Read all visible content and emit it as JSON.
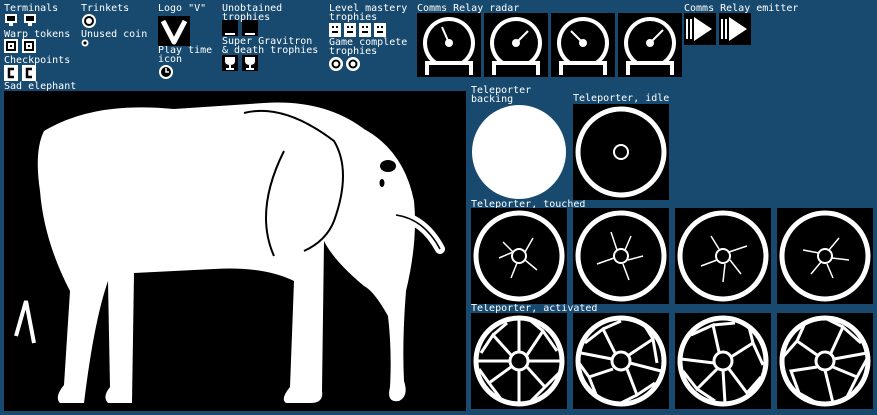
{
  "labels": {
    "terminals": "Terminals",
    "warp_tokens": "Warp tokens",
    "checkpoints": "Checkpoints",
    "sad_elephant": "Sad elephant",
    "trinkets": "Trinkets",
    "unused_coin": "Unused coin",
    "logo_v": "Logo \"V\"",
    "play_time_1": "Play time",
    "play_time_2": "icon",
    "unobtained_1": "Unobtained",
    "unobtained_2": "trophies",
    "super_1": "Super Gravitron",
    "super_2": "& death trophies",
    "level_mastery_1": "Level mastery",
    "level_mastery_2": "trophies",
    "game_complete_1": "Game complete",
    "game_complete_2": "trophies",
    "radar": "Comms Relay radar",
    "emitter": "Comms Relay emitter",
    "tp_backing_1": "Teleporter",
    "tp_backing_2": "backing",
    "tp_idle": "Teleporter, idle",
    "tp_touched": "Teleporter, touched",
    "tp_activated": "Teleporter, activated"
  },
  "colors": {
    "background": "#174a6e",
    "tile": "#000000",
    "sprite": "#ffffff"
  }
}
